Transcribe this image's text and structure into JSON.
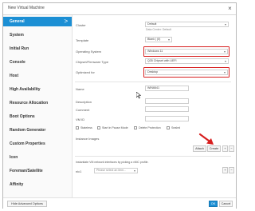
{
  "window": {
    "title": "New Virtual Machine"
  },
  "sidebar": {
    "items": [
      {
        "label": "General"
      },
      {
        "label": "System"
      },
      {
        "label": "Initial Run"
      },
      {
        "label": "Console"
      },
      {
        "label": "Host"
      },
      {
        "label": "High Availability"
      },
      {
        "label": "Resource Allocation"
      },
      {
        "label": "Boot Options"
      },
      {
        "label": "Random Generator"
      },
      {
        "label": "Custom Properties"
      },
      {
        "label": "Icon"
      },
      {
        "label": "Foreman/Satellite"
      },
      {
        "label": "Affinity"
      }
    ],
    "active_chevron": ">"
  },
  "form": {
    "cluster": {
      "label": "Cluster",
      "value": "Default",
      "note": "Data Center: Default"
    },
    "template": {
      "label": "Template",
      "value": "Blank | (0)"
    },
    "os": {
      "label": "Operating System",
      "value": "Windows 11"
    },
    "chipset": {
      "label": "Chipset/Firmware Type",
      "value": "Q35 Chipset with UEFI"
    },
    "optimized": {
      "label": "Optimized for",
      "value": "Desktop"
    },
    "name": {
      "label": "Name",
      "value": "WIN6641"
    },
    "description": {
      "label": "Description",
      "value": ""
    },
    "comment": {
      "label": "Comment",
      "value": ""
    },
    "vmid": {
      "label": "VM ID",
      "value": ""
    },
    "checkboxes": [
      {
        "label": "Stateless"
      },
      {
        "label": "Start in Pause Mode"
      },
      {
        "label": "Delete Protection"
      },
      {
        "label": "Sealed"
      }
    ],
    "instance_images": {
      "label": "Instance Images",
      "attach": "Attach",
      "create": "Create",
      "plus": "+",
      "minus": "−"
    },
    "nic": {
      "help": "Instantiate VM network interfaces by picking a vNIC profile.",
      "label": "nic1",
      "placeholder": "Please select an item...",
      "plus": "+",
      "minus": "−"
    },
    "dropdown_icon": "▾"
  },
  "footer": {
    "hide_advanced": "Hide Advanced Options",
    "ok": "OK",
    "cancel": "Cancel"
  },
  "colors": {
    "accent": "#1c8fd4",
    "highlight": "#d71f1f"
  }
}
